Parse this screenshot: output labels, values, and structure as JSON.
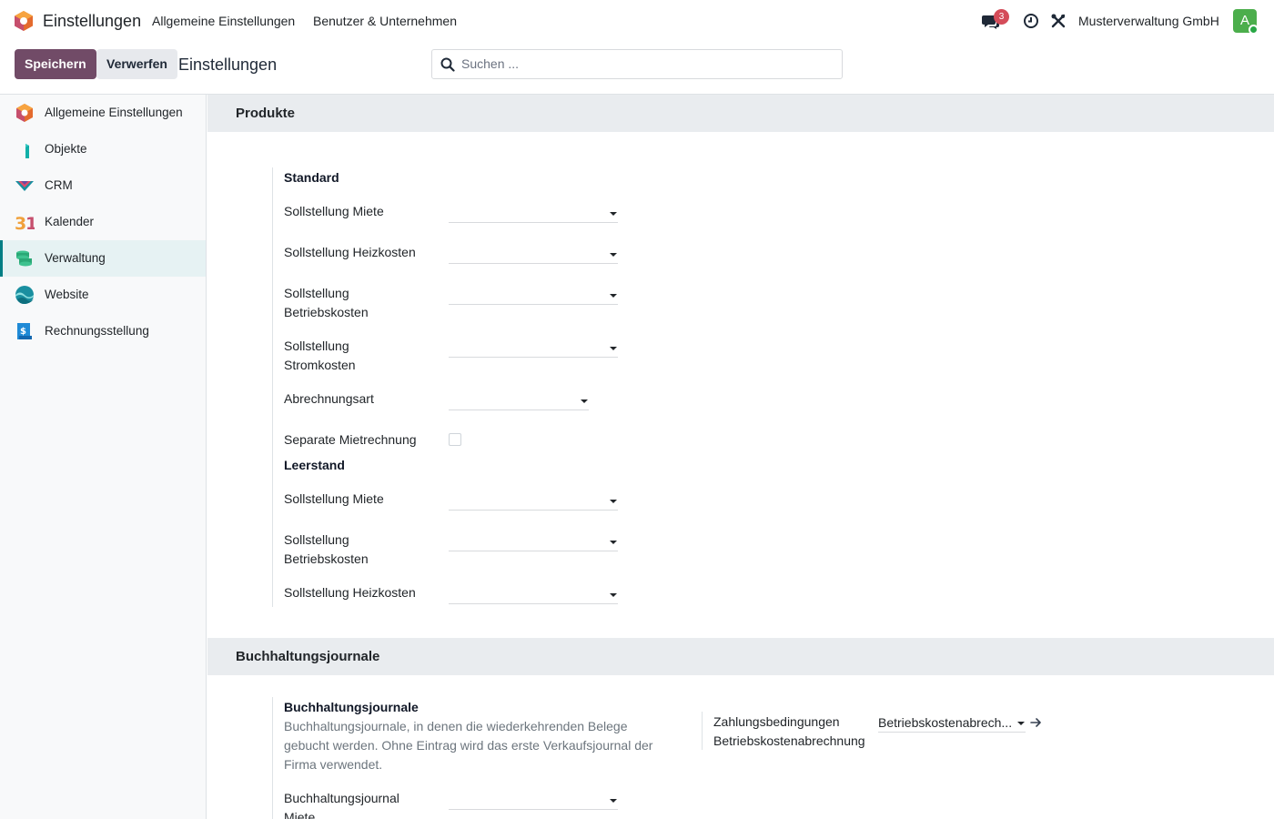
{
  "nav": {
    "app_title": "Einstellungen",
    "menu": [
      "Allgemeine Einstellungen",
      "Benutzer & Unternehmen"
    ],
    "messages_count": "3",
    "company": "Musterverwaltung GmbH",
    "avatar_letter": "A"
  },
  "control": {
    "save_label": "Speichern",
    "discard_label": "Verwerfen",
    "title": "Einstellungen",
    "search_placeholder": "Suchen ..."
  },
  "sidebar": {
    "items": [
      {
        "label": "Allgemeine Einstellungen",
        "icon": "settings-app-icon"
      },
      {
        "label": "Objekte",
        "icon": "objects-app-icon"
      },
      {
        "label": "CRM",
        "icon": "crm-app-icon"
      },
      {
        "label": "Kalender",
        "icon": "calendar-app-icon"
      },
      {
        "label": "Verwaltung",
        "icon": "management-app-icon",
        "active": true
      },
      {
        "label": "Website",
        "icon": "website-app-icon"
      },
      {
        "label": "Rechnungsstellung",
        "icon": "invoicing-app-icon"
      }
    ]
  },
  "products": {
    "title": "Produkte",
    "standard": {
      "title": "Standard",
      "fields": [
        {
          "label": "Sollstellung Miete",
          "value": ""
        },
        {
          "label": "Sollstellung Heizkosten",
          "value": ""
        },
        {
          "label_line1": "Sollstellung",
          "label_line2": "Betriebskosten",
          "value": ""
        },
        {
          "label_line1": "Sollstellung",
          "label_line2": "Stromkosten",
          "value": ""
        },
        {
          "label": "Abrechnungsart",
          "value": ""
        },
        {
          "label": "Separate Mietrechnung",
          "checked": false
        }
      ]
    },
    "vacancy": {
      "title": "Leerstand",
      "fields": [
        {
          "label": "Sollstellung Miete",
          "value": ""
        },
        {
          "label_line1": "Sollstellung",
          "label_line2": "Betriebskosten",
          "value": ""
        },
        {
          "label": "Sollstellung Heizkosten",
          "value": ""
        }
      ]
    }
  },
  "journals": {
    "title": "Buchhaltungsjournale",
    "block_title": "Buchhaltungsjournale",
    "help": "Buchhaltungsjournale, in denen die wiederkehrenden Belege gebucht werden. Ohne Eintrag wird das erste Verkaufsjournal der Firma verwendet.",
    "journal_rent_line1": "Buchhaltungsjournal",
    "journal_rent_line2": "Miete",
    "payment_terms_line1": "Zahlungsbedingungen",
    "payment_terms_line2": "Betriebskostenabrechnung",
    "payment_terms_value": "Betriebskostenabrech..."
  },
  "colors": {
    "primary": "#714b67",
    "accent": "#017e84",
    "section_bg": "#e9ecef"
  }
}
